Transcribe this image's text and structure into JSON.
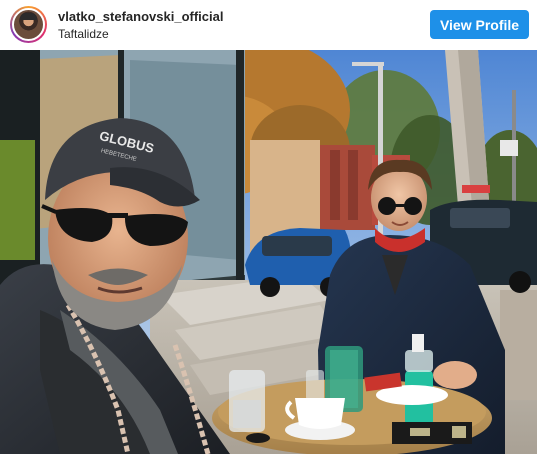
{
  "post": {
    "username": "vlatko_stefanovski_official",
    "location": "Taftalidze",
    "view_profile_label": "View Profile"
  },
  "photo": {
    "cap_text": "GLOBUS",
    "cap_subtext": "НЕВЕТЕСНЕ",
    "description": "Selfie of two men at an outdoor cafe table on a sunny day",
    "colors": {
      "accent": "#1e90e8",
      "sky": "#6f9fdd"
    }
  }
}
